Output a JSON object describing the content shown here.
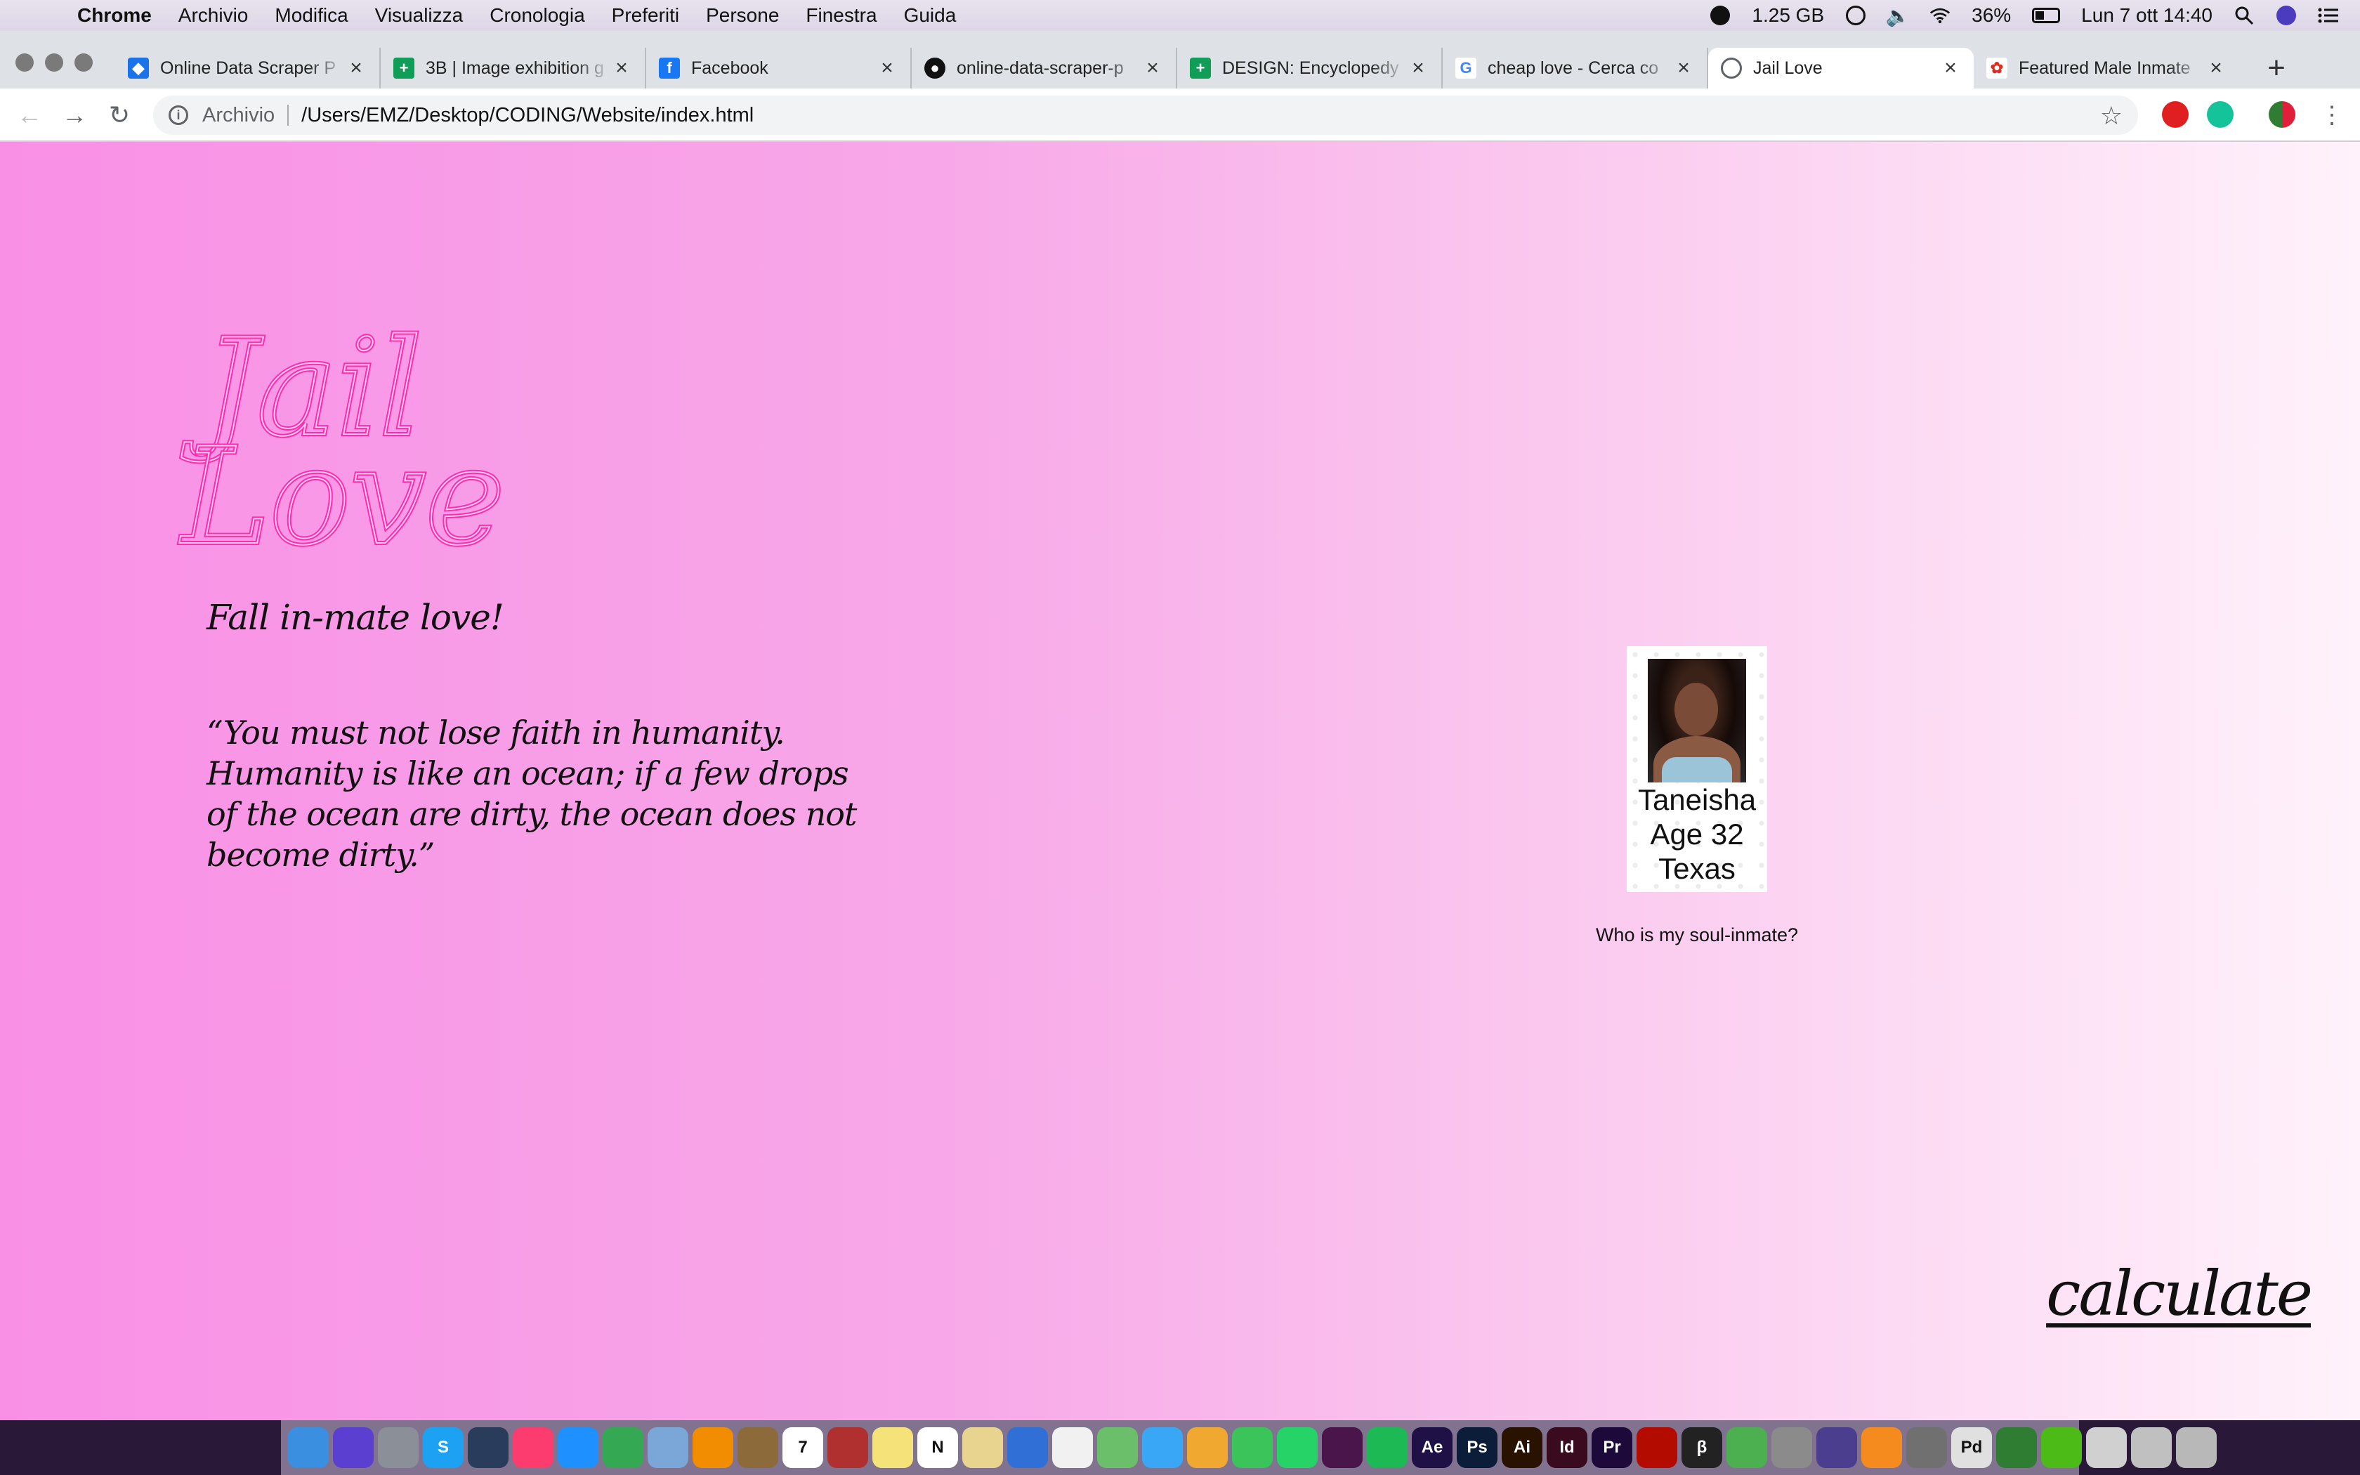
{
  "menubar": {
    "app_name": "Chrome",
    "menus": [
      "Archivio",
      "Modifica",
      "Visualizza",
      "Cronologia",
      "Preferiti",
      "Persone",
      "Finestra",
      "Guida"
    ],
    "memory": "1.25 GB",
    "battery": "36%",
    "datetime": "Lun 7 ott  14:40"
  },
  "tabs": [
    {
      "title": "Online Data Scraper P",
      "favicon": "layers-icon",
      "color": "#1a73e8"
    },
    {
      "title": "3B | Image exhibition g",
      "favicon": "sheets-icon",
      "color": "#0f9d58"
    },
    {
      "title": "Facebook",
      "favicon": "facebook-icon",
      "color": "#1877f2"
    },
    {
      "title": "online-data-scraper-p",
      "favicon": "github-icon",
      "color": "#111111"
    },
    {
      "title": "DESIGN: Encyclopedy",
      "favicon": "sheets-icon",
      "color": "#0f9d58"
    },
    {
      "title": "cheap love - Cerca co",
      "favicon": "google-icon",
      "color": "#4285f4"
    },
    {
      "title": "Jail Love",
      "favicon": "globe-icon",
      "color": "#5f6368"
    },
    {
      "title": "Featured Male Inmate",
      "favicon": "flower-icon",
      "color": "#d93025"
    }
  ],
  "omnibox": {
    "label": "Archivio",
    "url": "/Users/EMZ/Desktop/CODING/Website/index.html"
  },
  "page": {
    "logo_line1": "Jail",
    "logo_line2": "Love",
    "tagline": "Fall in-mate love!",
    "quote": "“You must not lose faith in humanity. Humanity is like an ocean; if a few drops of the ocean are dirty, the ocean does not become dirty.”",
    "profile": {
      "name": "Taneisha",
      "age": "Age 32",
      "state": "Texas"
    },
    "soul_link": "Who is my soul-inmate?",
    "calculate": "calculate",
    "accent_color": "#ff2ab0"
  },
  "dock": {
    "icons": [
      "finder-icon",
      "siri-icon",
      "launchpad-icon",
      "skype-icon",
      "quicktime-icon",
      "music-icon",
      "appstore-icon",
      "chrome-icon",
      "preview-icon",
      "vlc-icon",
      "notes-icon",
      "calendar-icon",
      "photobooth-icon",
      "stickies-icon",
      "notion-icon",
      "textedit-icon",
      "keynote-icon",
      "pages-icon",
      "maps-icon",
      "messages-icon",
      "photos-icon",
      "facetime-icon",
      "whatsapp-icon",
      "slack-icon",
      "spotify-icon",
      "aftereffects-icon",
      "photoshop-icon",
      "illustrator-icon",
      "indesign-icon",
      "premiere-icon",
      "acrobat-icon",
      "beta-icon",
      "browser-icon",
      "font-icon",
      "github-icon",
      "books-icon",
      "sysprefs-icon",
      "pd-icon",
      "memory-icon",
      "transfer-icon",
      "archive-icon",
      "grid-icon",
      "trash-icon"
    ],
    "labels": {
      "aftereffects-icon": "Ae",
      "photoshop-icon": "Ps",
      "illustrator-icon": "Ai",
      "indesign-icon": "Id",
      "premiere-icon": "Pr",
      "skype-icon": "S",
      "notion-icon": "N",
      "pd-icon": "Pd",
      "beta-icon": "β",
      "calendar-icon": "7"
    },
    "colors": {
      "finder-icon": "#3b8fe0",
      "siri-icon": "#5b3fd0",
      "launchpad-icon": "#8a8f98",
      "skype-icon": "#1da1f2",
      "quicktime-icon": "#2a3c5c",
      "music-icon": "#fc3c6e",
      "appstore-icon": "#1e90ff",
      "chrome-icon": "#34a853",
      "preview-icon": "#7aa6d8",
      "vlc-icon": "#f28c00",
      "notes-icon": "#8c6a3a",
      "calendar-icon": "#ffffff",
      "photobooth-icon": "#b0302f",
      "stickies-icon": "#f5e37a",
      "notion-icon": "#ffffff",
      "textedit-icon": "#e9d48f",
      "keynote-icon": "#2f6fd6",
      "pages-icon": "#f1f1f1",
      "maps-icon": "#6cbf6a",
      "messages-icon": "#39a7f5",
      "photos-icon": "#f0a830",
      "facetime-icon": "#3ac45a",
      "whatsapp-icon": "#25d366",
      "slack-icon": "#4a154b",
      "spotify-icon": "#1db954",
      "aftereffects-icon": "#1f1045",
      "photoshop-icon": "#0b1d39",
      "illustrator-icon": "#2a1200",
      "indesign-icon": "#3a0a1e",
      "premiere-icon": "#1e0a3a",
      "acrobat-icon": "#b30b00",
      "beta-icon": "#222222",
      "browser-icon": "#4caf50",
      "font-icon": "#8b8b8b",
      "github-icon": "#4c3e8e",
      "books-icon": "#f58a1f",
      "sysprefs-icon": "#707070",
      "pd-icon": "#e0e0e0",
      "memory-icon": "#2f7d32",
      "transfer-icon": "#4cbb17",
      "archive-icon": "#d0d0d0",
      "grid-icon": "#c0c0c0",
      "trash-icon": "#b8b8b8"
    }
  }
}
